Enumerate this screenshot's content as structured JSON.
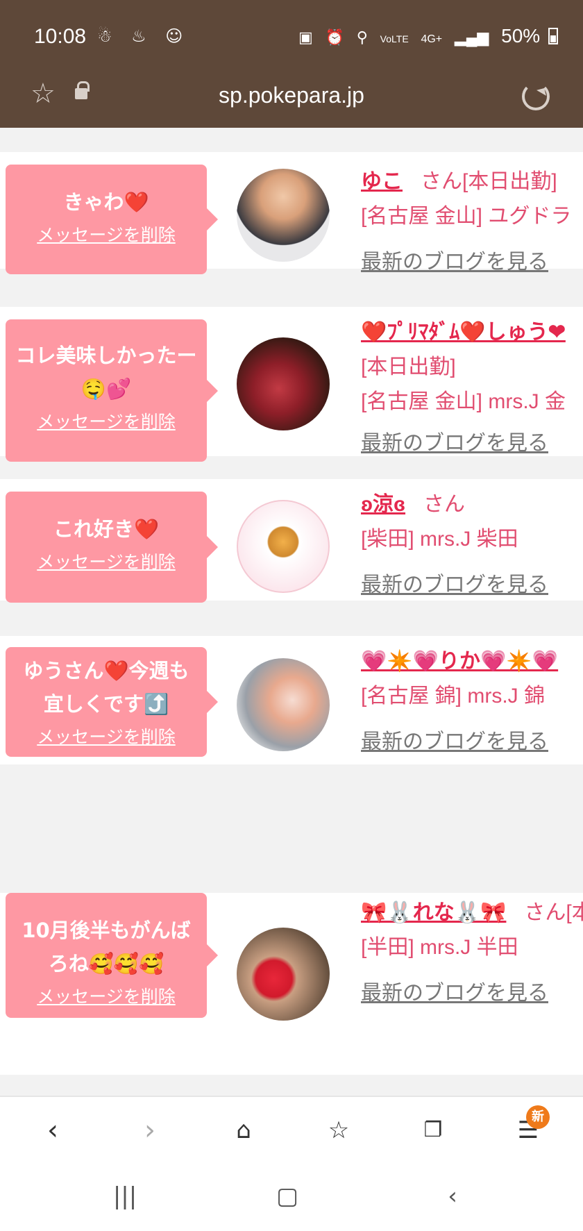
{
  "status_bar": {
    "time": "10:08",
    "battery": "50%",
    "network": "4G+",
    "volte": "VoLTE"
  },
  "url_bar": {
    "url": "sp.pokepara.jp"
  },
  "messages": [
    {
      "message": "きゃわ❤️",
      "delete_label": "メッセージを削除",
      "name": "ゆこ",
      "suffix": "さん[本日出勤]",
      "line2": "[名古屋 金山] ユグドラ",
      "line3": "",
      "blog_link": "最新のブログを見る"
    },
    {
      "message": "コレ美味しかったー🤤💕",
      "delete_label": "メッセージを削除",
      "name": "❤️ﾌﾟﾘﾏﾀﾞﾑ❤️しゅう❤",
      "suffix": "",
      "line2": "[本日出勤]",
      "line3": "[名古屋 金山] mrs.J 金",
      "blog_link": "最新のブログを見る"
    },
    {
      "message": "これ好き❤️",
      "delete_label": "メッセージを削除",
      "name": "ʚ涼ɞ",
      "suffix": "さん",
      "line2": "[柴田] mrs.J 柴田",
      "line3": "",
      "blog_link": "最新のブログを見る"
    },
    {
      "message": "ゆうさん❤️今週も宜しくです⤴️",
      "delete_label": "メッセージを削除",
      "name": "💗✴️💗りか💗✴️💗",
      "suffix": "",
      "line2": "[名古屋 錦] mrs.J 錦",
      "line3": "",
      "blog_link": "最新のブログを見る"
    },
    {
      "message": "10月後半もがんばろね🥰🥰🥰",
      "delete_label": "メッセージを削除",
      "name": "🎀🐰れな🐰🎀",
      "suffix": "さん[本日出勤]",
      "line2": "[半田] mrs.J 半田",
      "line3": "",
      "blog_link": "最新のブログを見る"
    }
  ],
  "bottom_nav": {
    "back": "‹",
    "forward": "›",
    "badge": "新"
  },
  "colors": {
    "topbar": "#5e4839",
    "bubble": "#fe98a3",
    "name": "#e4274d",
    "info_text": "#e14d70",
    "badge": "#ef7a1a"
  }
}
